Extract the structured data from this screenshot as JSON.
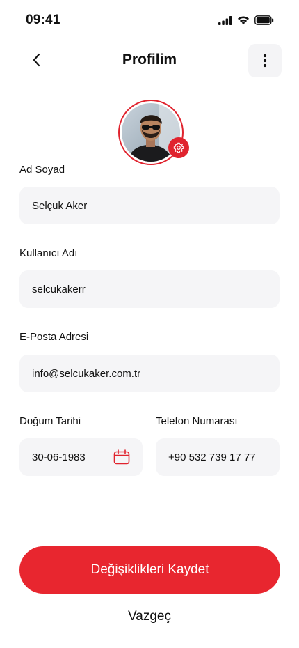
{
  "status_bar": {
    "time": "09:41"
  },
  "header": {
    "title": "Profilim",
    "back_icon": "chevron-left-icon",
    "more_icon": "more-vertical-icon"
  },
  "avatar": {
    "settings_icon": "gear-icon",
    "accent_color": "#e0232e"
  },
  "form": {
    "full_name": {
      "label": "Ad Soyad",
      "value": "Selçuk Aker"
    },
    "username": {
      "label": "Kullanıcı Adı",
      "value": "selcukakerr"
    },
    "email": {
      "label": "E-Posta Adresi",
      "value": "info@selcukaker.com.tr"
    },
    "birth_date": {
      "label": "Doğum Tarihi",
      "value": "30-06-1983",
      "icon": "calendar-icon"
    },
    "phone": {
      "label": "Telefon Numarası",
      "value": "+90 532 739 17 77"
    }
  },
  "actions": {
    "save_label": "Değişiklikleri Kaydet",
    "cancel_label": "Vazgeç",
    "primary_color": "#e8262f"
  }
}
